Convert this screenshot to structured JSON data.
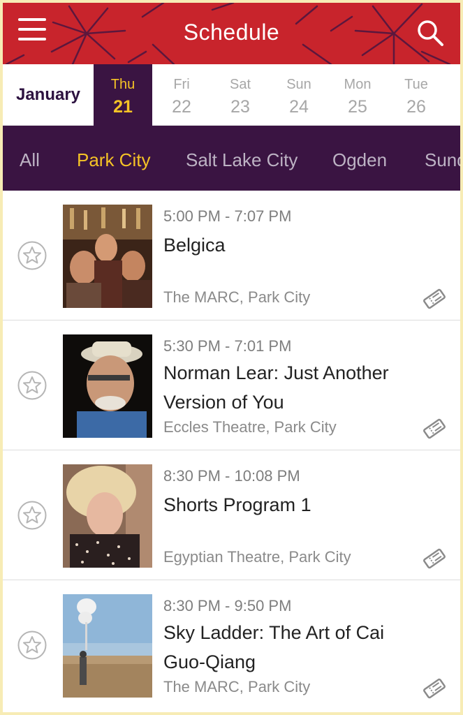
{
  "header": {
    "title": "Schedule",
    "menu_icon": "hamburger-menu-icon",
    "search_icon": "search-icon",
    "accent_color": "#c8242c"
  },
  "datebar": {
    "month": "January",
    "days": [
      {
        "name": "Thu",
        "date": "21",
        "selected": true
      },
      {
        "name": "Fri",
        "date": "22",
        "selected": false
      },
      {
        "name": "Sat",
        "date": "23",
        "selected": false
      },
      {
        "name": "Sun",
        "date": "24",
        "selected": false
      },
      {
        "name": "Mon",
        "date": "25",
        "selected": false
      },
      {
        "name": "Tue",
        "date": "26",
        "selected": false
      }
    ]
  },
  "locations": {
    "tabs": [
      "All",
      "Park City",
      "Salt Lake City",
      "Ogden",
      "Sund"
    ],
    "selected": "Park City"
  },
  "events": [
    {
      "time": "5:00 PM - 7:07 PM",
      "title": "Belgica",
      "venue": "The MARC, Park City"
    },
    {
      "time": "5:30 PM - 7:01 PM",
      "title": "Norman Lear: Just Another Version of You",
      "venue": "Eccles Theatre, Park City"
    },
    {
      "time": "8:30 PM - 10:08 PM",
      "title": "Shorts Program 1",
      "venue": "Egyptian Theatre, Park City"
    },
    {
      "time": "8:30 PM - 9:50 PM",
      "title": "Sky Ladder: The Art of Cai Guo-Qiang",
      "venue": "The MARC, Park City"
    }
  ],
  "icons": {
    "favorite": "star-outline-icon",
    "ticket": "ticket-icon"
  },
  "colors": {
    "nav_background": "#3a1442",
    "highlight": "#f5c326"
  }
}
